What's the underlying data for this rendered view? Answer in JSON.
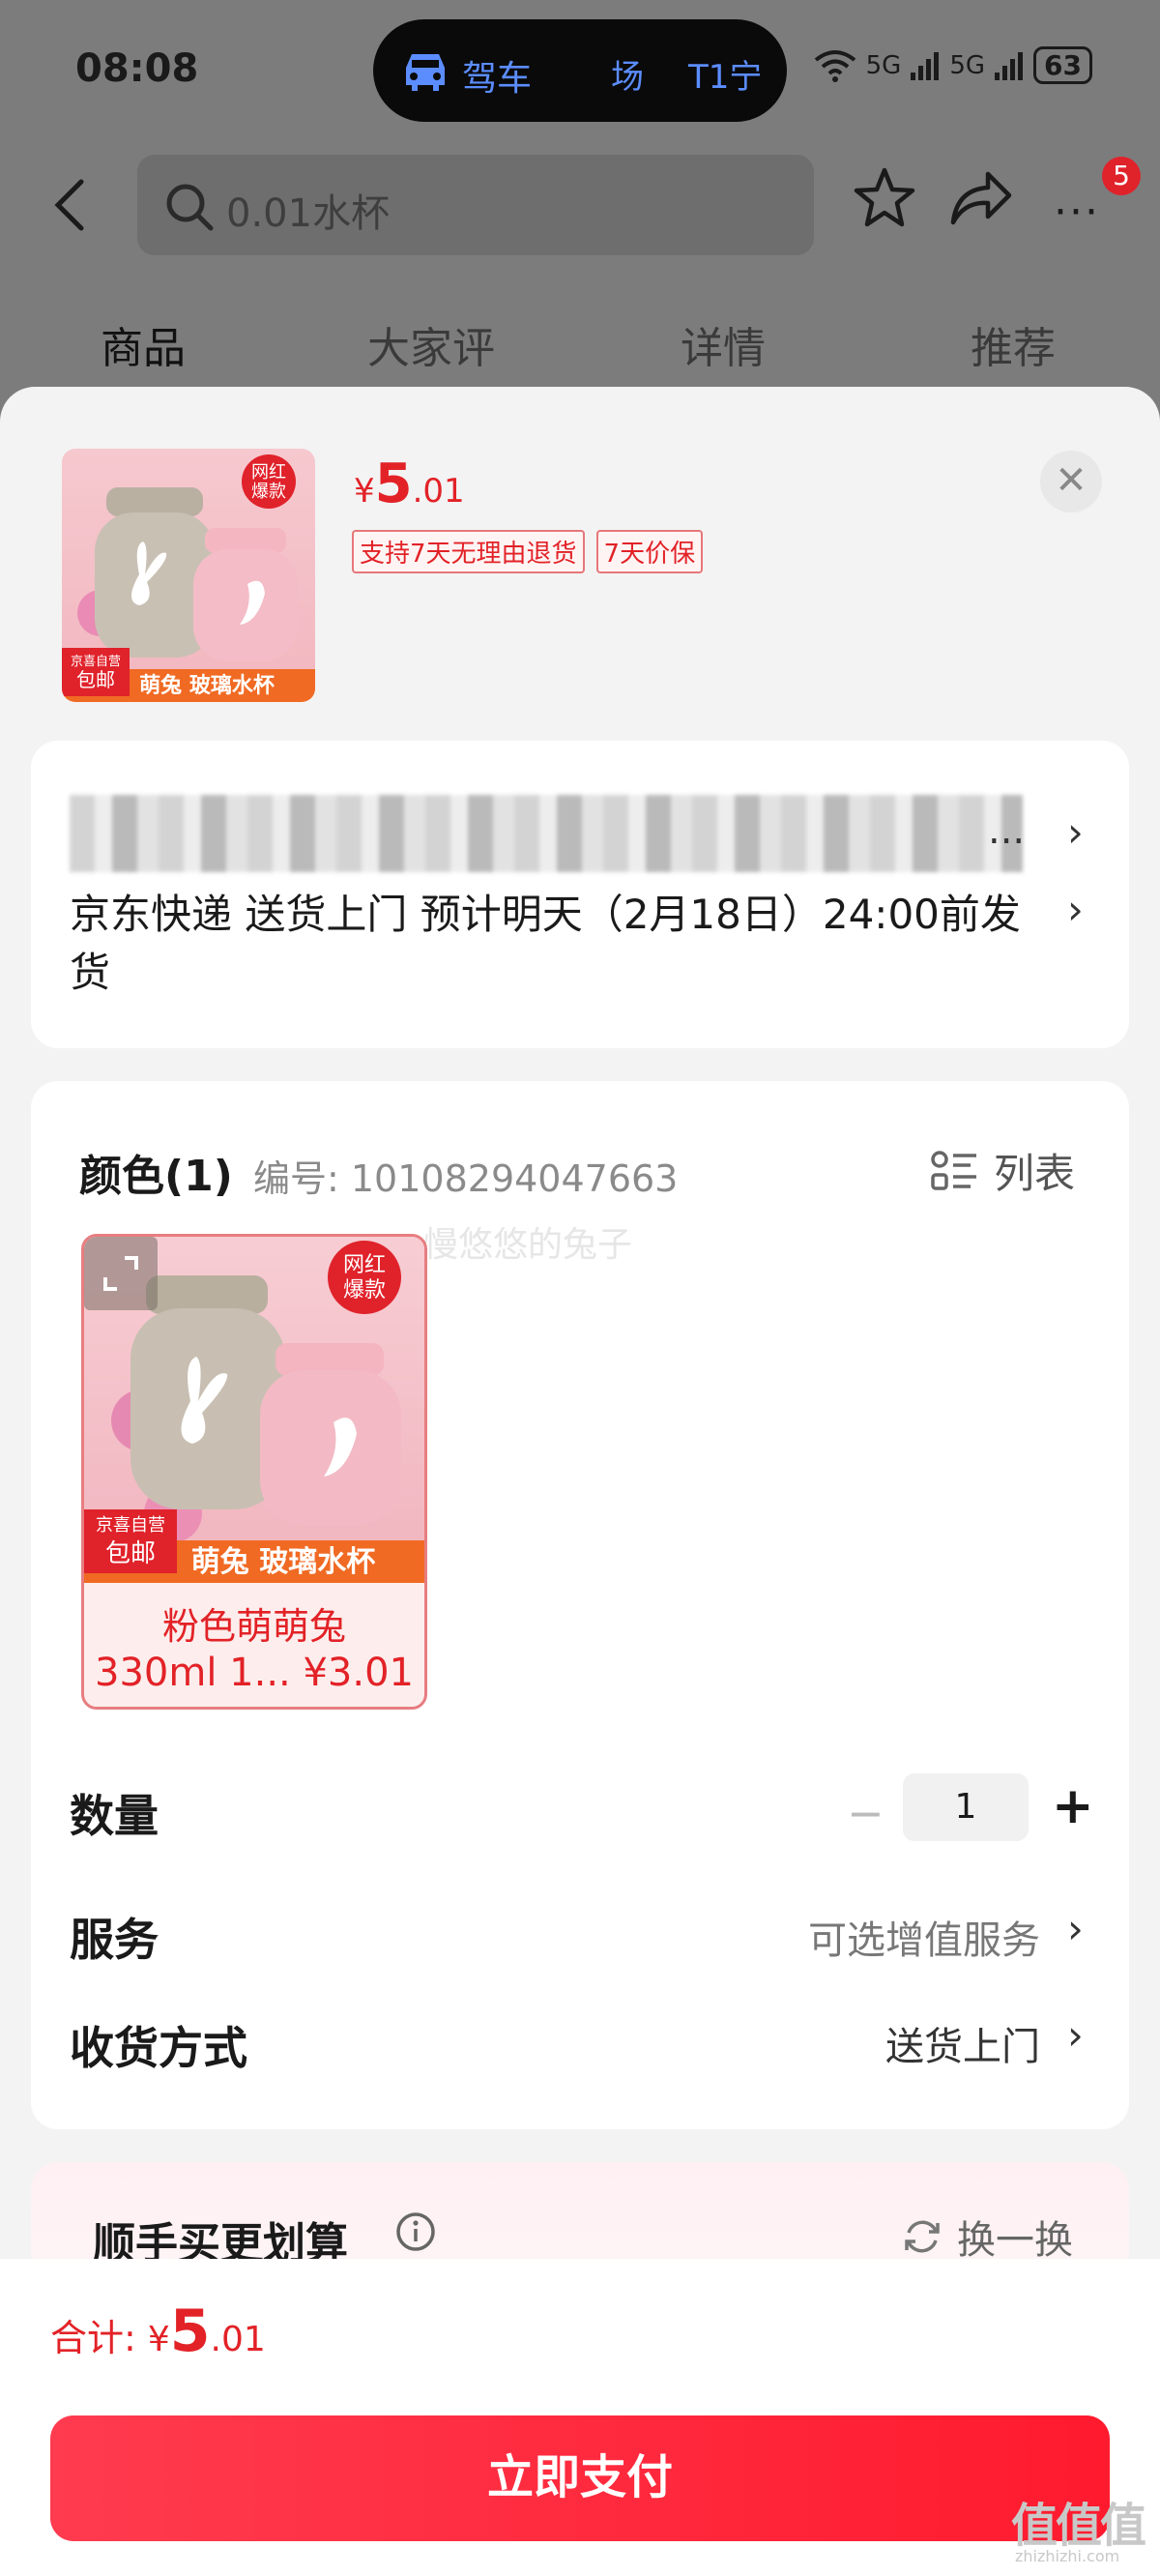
{
  "status_bar": {
    "time": "08:08",
    "island_text1": "驾车",
    "island_text2": "场",
    "island_text3": "T1宁",
    "network1": "5G",
    "network2": "5G",
    "battery": "63"
  },
  "nav": {
    "search_text": "0.01水杯",
    "badge_count": "5",
    "more_label": "···"
  },
  "tabs": [
    {
      "label": "商品"
    },
    {
      "label": "大家评"
    },
    {
      "label": "详情"
    },
    {
      "label": "推荐"
    }
  ],
  "product": {
    "price_symbol": "¥",
    "price_int": "5",
    "price_dec": ".01",
    "tags": [
      "支持7天无理由退货",
      "7天价保"
    ],
    "thumb_badge": "网红\n爆款",
    "thumb_badge_line1": "网红",
    "thumb_badge_line2": "爆款",
    "thumb_banner": "萌兔 玻璃水杯",
    "thumb_store": "京喜自营",
    "thumb_ship": "包邮"
  },
  "address": {
    "more": "...",
    "shipping": "京东快递 送货上门 预计明天（2月18日）24:00前发货"
  },
  "spec": {
    "color_title": "颜色(1)",
    "sku_number": "编号: 10108294047663",
    "list_label": "列表",
    "watermark": "慢悠悠的兔子",
    "sku_name": "粉色萌萌兔",
    "sku_price": "330ml 1... ¥3.01",
    "quantity_label": "数量",
    "quantity_value": "1",
    "minus": "−",
    "plus": "+",
    "service_label": "服务",
    "service_value": "可选增值服务",
    "delivery_label": "收货方式",
    "delivery_value": "送货上门"
  },
  "recommend": {
    "title": "顺手买更划算",
    "swap_label": "换一换"
  },
  "bottom": {
    "total_label": "合计: ",
    "total_symbol": "¥",
    "total_int": "5",
    "total_dec": ".01",
    "pay_label": "立即支付"
  },
  "site_mark": {
    "main": "值值值",
    "sub": "zhizhizhi.com"
  },
  "colors": {
    "accent_red": "#e22227",
    "pay_button": "#ff2239",
    "overlay": "#7c7c7c"
  }
}
